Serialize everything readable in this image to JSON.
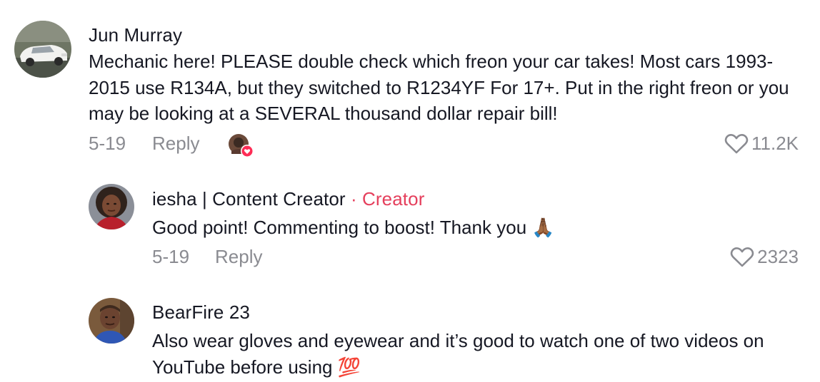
{
  "comments": [
    {
      "author": "Jun Murray",
      "text": "Mechanic here! PLEASE double check which freon your car takes! Most cars 1993-2015 use R134A, but they switched to R1234YF For 17+. Put in the right freon or you may be looking at a SEVERAL thousand dollar repair bill!",
      "date": "5-19",
      "reply_label": "Reply",
      "likes": "11.2K",
      "avatar_icon": "car-photo-avatar",
      "liked_by_creator": true
    }
  ],
  "replies": [
    {
      "author": "iesha | Content Creator",
      "badge": "· Creator",
      "text": "Good point! Commenting to boost! Thank you",
      "emoji": "🙏🏾",
      "date": "5-19",
      "reply_label": "Reply",
      "likes": "2323",
      "avatar_icon": "woman-portrait-avatar"
    },
    {
      "author": "BearFire 23",
      "text": "Also wear gloves and eyewear and it’s good to watch one of two videos on YouTube before using",
      "emoji": "💯",
      "avatar_icon": "man-portrait-avatar"
    }
  ],
  "colors": {
    "text": "#161823",
    "meta": "#8a8b91",
    "creator_accent": "#e53f5c",
    "heart_badge": "#fe2c55"
  }
}
